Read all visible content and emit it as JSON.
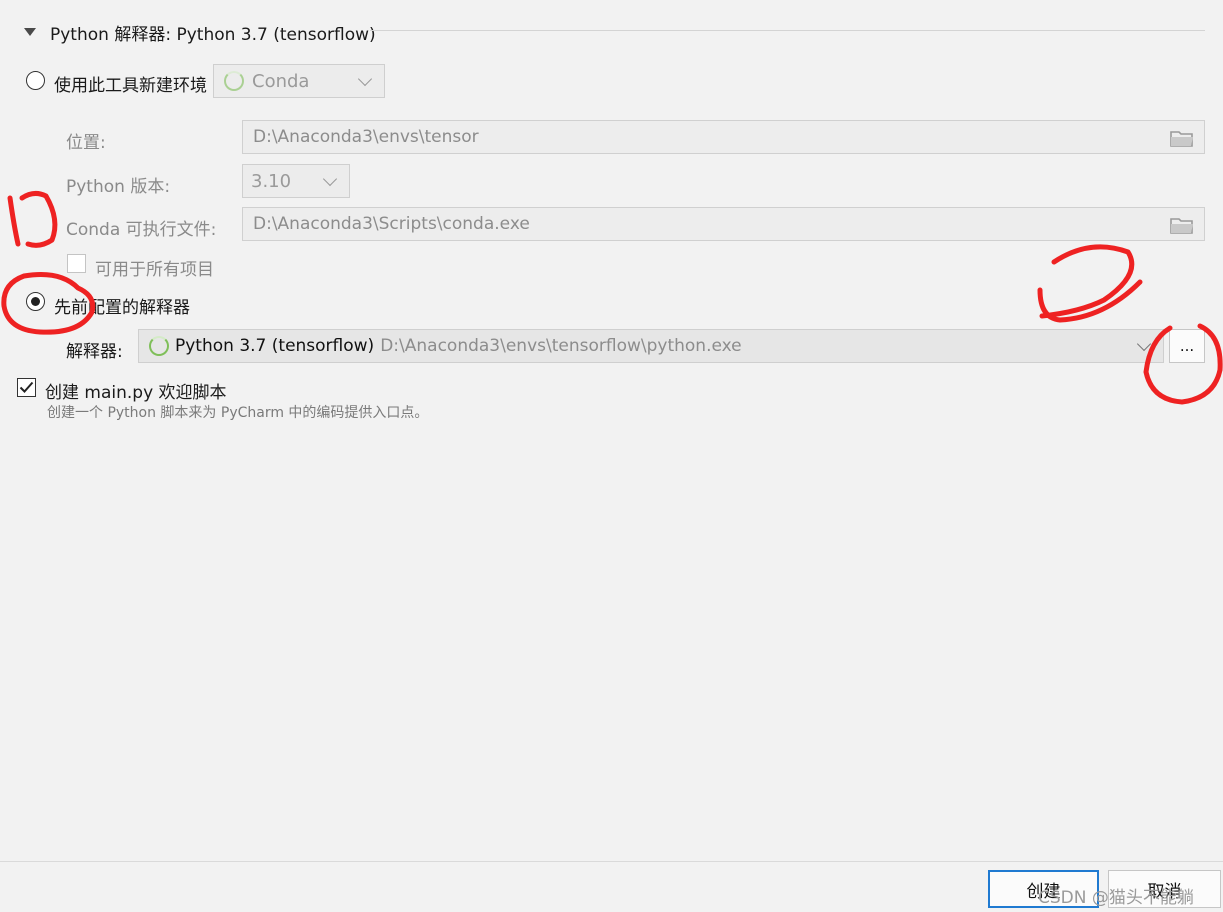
{
  "section": {
    "title": "Python 解释器: Python 3.7 (tensorflow)"
  },
  "new_env": {
    "radio_label": "使用此工具新建环境",
    "tool_value": "Conda",
    "location_label": "位置:",
    "location_value": "D:\\Anaconda3\\envs\\tensor",
    "python_version_label": "Python 版本:",
    "python_version_value": "3.10",
    "conda_exe_label": "Conda 可执行文件:",
    "conda_exe_value": "D:\\Anaconda3\\Scripts\\conda.exe",
    "all_projects_label": "可用于所有项目"
  },
  "existing": {
    "radio_label": "先前配置的解释器",
    "interpreter_label": "解释器:",
    "interpreter_name": "Python 3.7 (tensorflow)",
    "interpreter_path": "D:\\Anaconda3\\envs\\tensorflow\\python.exe",
    "browse_label": "..."
  },
  "welcome": {
    "checkbox_label": "创建 main.py 欢迎脚本",
    "hint": "创建一个 Python 脚本来为 PyCharm 中的编码提供入口点。"
  },
  "footer": {
    "create_label": "创建",
    "cancel_label": "取消",
    "watermark": "CSDN @猫头不能躺"
  },
  "annotations": {
    "mark_1": "1",
    "mark_2": "2"
  },
  "colors": {
    "accent": "#1f7ad1",
    "annotation": "#ee2222",
    "conda_green": "#7fbf59"
  }
}
